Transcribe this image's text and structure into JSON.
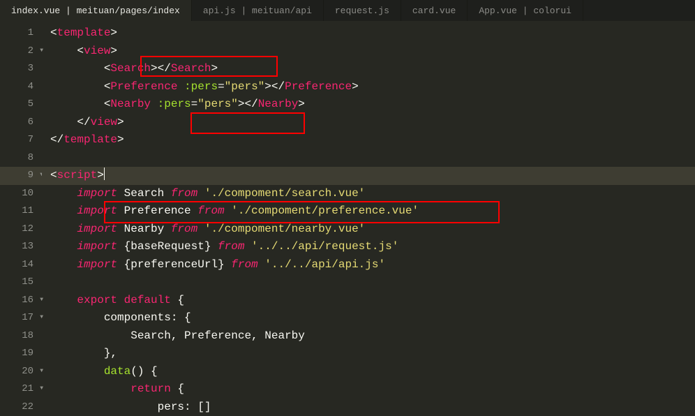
{
  "tabs": [
    {
      "label": "index.vue | meituan/pages/index",
      "active": true
    },
    {
      "label": "api.js | meituan/api",
      "active": false
    },
    {
      "label": "request.js",
      "active": false
    },
    {
      "label": "card.vue",
      "active": false
    },
    {
      "label": "App.vue | colorui",
      "active": false
    }
  ],
  "lines": {
    "l1": "1",
    "l2": "2",
    "l3": "3",
    "l4": "4",
    "l5": "5",
    "l6": "6",
    "l7": "7",
    "l8": "8",
    "l9": "9",
    "l10": "10",
    "l11": "11",
    "l12": "12",
    "l13": "13",
    "l14": "14",
    "l15": "15",
    "l16": "16",
    "l17": "17",
    "l18": "18",
    "l19": "19",
    "l20": "20",
    "l21": "21",
    "l22": "22"
  },
  "tok": {
    "lt": "<",
    "gt": ">",
    "lts": "</",
    "sp1": "    ",
    "sp2": "        ",
    "sp3": "            ",
    "sp4": "                ",
    "template": "template",
    "view": "view",
    "Search": "Search",
    "Preference": "Preference",
    "Nearby": "Nearby",
    "pers_attr": ":pers",
    "eq": "=",
    "pers_val": "\"pers\"",
    "script": "script",
    "import": "import",
    "from": "from",
    "SearchId": " Search ",
    "PreferenceId": " Preference ",
    "NearbyId": " Nearby ",
    "baseReq": " {baseRequest} ",
    "prefUrl": " {preferenceUrl} ",
    "p_search": " './compoment/search.vue'",
    "p_pref": " './compoment/preference.vue'",
    "p_nearby": " './compoment/nearby.vue'",
    "p_req": " '../../api/request.js'",
    "p_api": " '../../api/api.js'",
    "export": "export",
    "default": " default",
    "obrace": " {",
    "components": "components",
    "colon_brace": ": {",
    "comp_list": "Search, Preference, Nearby",
    "cbrace_comma": "},",
    "data": "data",
    "paren_brace": "() {",
    "return": "return",
    "obrace2": " {",
    "pers_arr": "pers: []"
  }
}
